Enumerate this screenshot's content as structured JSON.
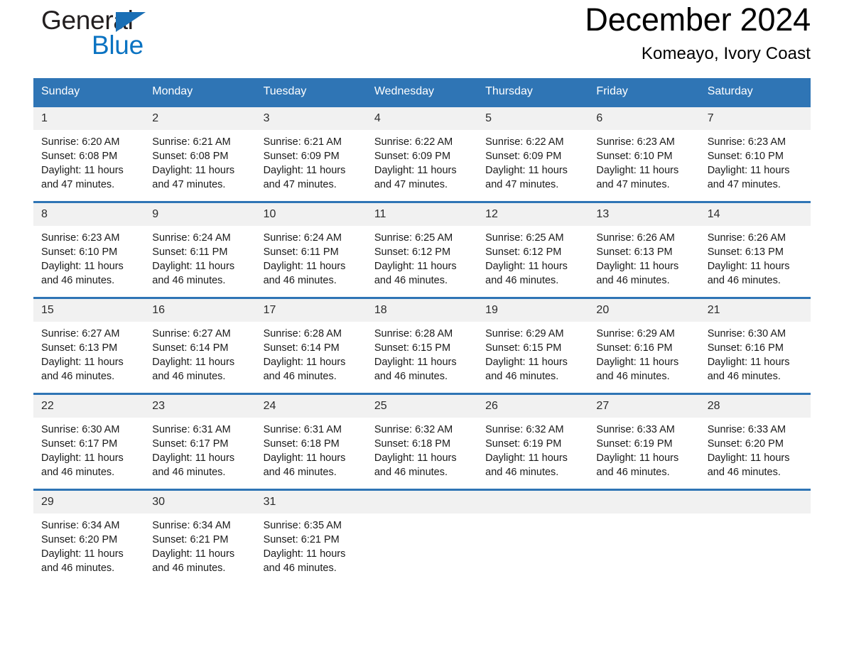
{
  "brand": {
    "name_top": "General",
    "name_bottom": "Blue",
    "color_black": "#231f20",
    "color_blue": "#0a73c2"
  },
  "header": {
    "month_title": "December 2024",
    "location": "Komeayo, Ivory Coast"
  },
  "theme": {
    "header_blue": "#2f75b5",
    "daynum_band": "#f1f1f1",
    "text": "#1a1a1a",
    "header_text": "#ffffff"
  },
  "weekdays": [
    "Sunday",
    "Monday",
    "Tuesday",
    "Wednesday",
    "Thursday",
    "Friday",
    "Saturday"
  ],
  "labels": {
    "sunrise_prefix": "Sunrise:",
    "sunset_prefix": "Sunset:",
    "daylight_prefix": "Daylight:"
  },
  "weeks": [
    {
      "days": [
        {
          "num": "1",
          "sunrise": "Sunrise: 6:20 AM",
          "sunset": "Sunset: 6:08 PM",
          "daylight": "Daylight: 11 hours and 47 minutes."
        },
        {
          "num": "2",
          "sunrise": "Sunrise: 6:21 AM",
          "sunset": "Sunset: 6:08 PM",
          "daylight": "Daylight: 11 hours and 47 minutes."
        },
        {
          "num": "3",
          "sunrise": "Sunrise: 6:21 AM",
          "sunset": "Sunset: 6:09 PM",
          "daylight": "Daylight: 11 hours and 47 minutes."
        },
        {
          "num": "4",
          "sunrise": "Sunrise: 6:22 AM",
          "sunset": "Sunset: 6:09 PM",
          "daylight": "Daylight: 11 hours and 47 minutes."
        },
        {
          "num": "5",
          "sunrise": "Sunrise: 6:22 AM",
          "sunset": "Sunset: 6:09 PM",
          "daylight": "Daylight: 11 hours and 47 minutes."
        },
        {
          "num": "6",
          "sunrise": "Sunrise: 6:23 AM",
          "sunset": "Sunset: 6:10 PM",
          "daylight": "Daylight: 11 hours and 47 minutes."
        },
        {
          "num": "7",
          "sunrise": "Sunrise: 6:23 AM",
          "sunset": "Sunset: 6:10 PM",
          "daylight": "Daylight: 11 hours and 47 minutes."
        }
      ]
    },
    {
      "days": [
        {
          "num": "8",
          "sunrise": "Sunrise: 6:23 AM",
          "sunset": "Sunset: 6:10 PM",
          "daylight": "Daylight: 11 hours and 46 minutes."
        },
        {
          "num": "9",
          "sunrise": "Sunrise: 6:24 AM",
          "sunset": "Sunset: 6:11 PM",
          "daylight": "Daylight: 11 hours and 46 minutes."
        },
        {
          "num": "10",
          "sunrise": "Sunrise: 6:24 AM",
          "sunset": "Sunset: 6:11 PM",
          "daylight": "Daylight: 11 hours and 46 minutes."
        },
        {
          "num": "11",
          "sunrise": "Sunrise: 6:25 AM",
          "sunset": "Sunset: 6:12 PM",
          "daylight": "Daylight: 11 hours and 46 minutes."
        },
        {
          "num": "12",
          "sunrise": "Sunrise: 6:25 AM",
          "sunset": "Sunset: 6:12 PM",
          "daylight": "Daylight: 11 hours and 46 minutes."
        },
        {
          "num": "13",
          "sunrise": "Sunrise: 6:26 AM",
          "sunset": "Sunset: 6:13 PM",
          "daylight": "Daylight: 11 hours and 46 minutes."
        },
        {
          "num": "14",
          "sunrise": "Sunrise: 6:26 AM",
          "sunset": "Sunset: 6:13 PM",
          "daylight": "Daylight: 11 hours and 46 minutes."
        }
      ]
    },
    {
      "days": [
        {
          "num": "15",
          "sunrise": "Sunrise: 6:27 AM",
          "sunset": "Sunset: 6:13 PM",
          "daylight": "Daylight: 11 hours and 46 minutes."
        },
        {
          "num": "16",
          "sunrise": "Sunrise: 6:27 AM",
          "sunset": "Sunset: 6:14 PM",
          "daylight": "Daylight: 11 hours and 46 minutes."
        },
        {
          "num": "17",
          "sunrise": "Sunrise: 6:28 AM",
          "sunset": "Sunset: 6:14 PM",
          "daylight": "Daylight: 11 hours and 46 minutes."
        },
        {
          "num": "18",
          "sunrise": "Sunrise: 6:28 AM",
          "sunset": "Sunset: 6:15 PM",
          "daylight": "Daylight: 11 hours and 46 minutes."
        },
        {
          "num": "19",
          "sunrise": "Sunrise: 6:29 AM",
          "sunset": "Sunset: 6:15 PM",
          "daylight": "Daylight: 11 hours and 46 minutes."
        },
        {
          "num": "20",
          "sunrise": "Sunrise: 6:29 AM",
          "sunset": "Sunset: 6:16 PM",
          "daylight": "Daylight: 11 hours and 46 minutes."
        },
        {
          "num": "21",
          "sunrise": "Sunrise: 6:30 AM",
          "sunset": "Sunset: 6:16 PM",
          "daylight": "Daylight: 11 hours and 46 minutes."
        }
      ]
    },
    {
      "days": [
        {
          "num": "22",
          "sunrise": "Sunrise: 6:30 AM",
          "sunset": "Sunset: 6:17 PM",
          "daylight": "Daylight: 11 hours and 46 minutes."
        },
        {
          "num": "23",
          "sunrise": "Sunrise: 6:31 AM",
          "sunset": "Sunset: 6:17 PM",
          "daylight": "Daylight: 11 hours and 46 minutes."
        },
        {
          "num": "24",
          "sunrise": "Sunrise: 6:31 AM",
          "sunset": "Sunset: 6:18 PM",
          "daylight": "Daylight: 11 hours and 46 minutes."
        },
        {
          "num": "25",
          "sunrise": "Sunrise: 6:32 AM",
          "sunset": "Sunset: 6:18 PM",
          "daylight": "Daylight: 11 hours and 46 minutes."
        },
        {
          "num": "26",
          "sunrise": "Sunrise: 6:32 AM",
          "sunset": "Sunset: 6:19 PM",
          "daylight": "Daylight: 11 hours and 46 minutes."
        },
        {
          "num": "27",
          "sunrise": "Sunrise: 6:33 AM",
          "sunset": "Sunset: 6:19 PM",
          "daylight": "Daylight: 11 hours and 46 minutes."
        },
        {
          "num": "28",
          "sunrise": "Sunrise: 6:33 AM",
          "sunset": "Sunset: 6:20 PM",
          "daylight": "Daylight: 11 hours and 46 minutes."
        }
      ]
    },
    {
      "days": [
        {
          "num": "29",
          "sunrise": "Sunrise: 6:34 AM",
          "sunset": "Sunset: 6:20 PM",
          "daylight": "Daylight: 11 hours and 46 minutes."
        },
        {
          "num": "30",
          "sunrise": "Sunrise: 6:34 AM",
          "sunset": "Sunset: 6:21 PM",
          "daylight": "Daylight: 11 hours and 46 minutes."
        },
        {
          "num": "31",
          "sunrise": "Sunrise: 6:35 AM",
          "sunset": "Sunset: 6:21 PM",
          "daylight": "Daylight: 11 hours and 46 minutes."
        },
        {
          "num": "",
          "sunrise": "",
          "sunset": "",
          "daylight": ""
        },
        {
          "num": "",
          "sunrise": "",
          "sunset": "",
          "daylight": ""
        },
        {
          "num": "",
          "sunrise": "",
          "sunset": "",
          "daylight": ""
        },
        {
          "num": "",
          "sunrise": "",
          "sunset": "",
          "daylight": ""
        }
      ]
    }
  ]
}
